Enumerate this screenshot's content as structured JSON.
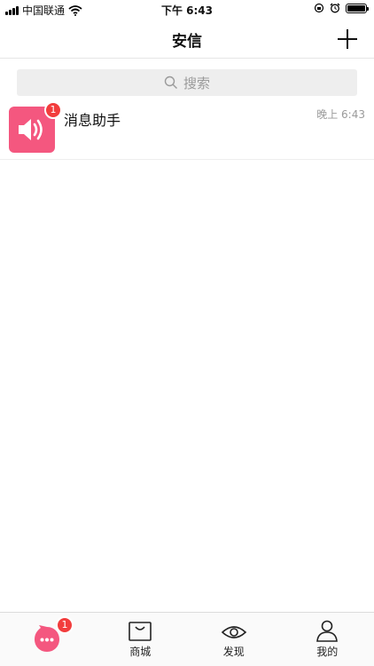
{
  "status_bar": {
    "carrier": "中国联通",
    "time": "下午 6:43"
  },
  "nav": {
    "title": "安信",
    "add_icon": "plus-icon"
  },
  "search": {
    "placeholder": "搜索",
    "icon": "search-icon"
  },
  "conversations": [
    {
      "title": "消息助手",
      "time": "晚上 6:43",
      "unread": "1",
      "icon": "speaker-icon",
      "avatar_color": "#f4577f"
    }
  ],
  "tabbar": {
    "chat_badge": "1",
    "tabs": [
      {
        "label": "",
        "icon": "chat-bubble-icon",
        "active": true
      },
      {
        "label": "商城",
        "icon": "shopping-bag-icon"
      },
      {
        "label": "发现",
        "icon": "eye-icon"
      },
      {
        "label": "我的",
        "icon": "person-icon"
      }
    ]
  },
  "colors": {
    "accent": "#f4577f",
    "badge": "#f23d3d",
    "search_bg": "#eeeeee"
  }
}
